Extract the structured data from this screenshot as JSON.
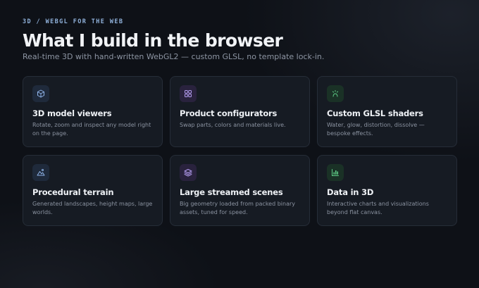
{
  "header": {
    "eyebrow": "3D / WEBGL FOR THE WEB",
    "title": "What I build in the browser",
    "subtitle": "Real-time 3D with hand-written WebGL2 — custom GLSL, no template lock-in."
  },
  "colors": {
    "background": "#0e1117",
    "card": "#161b23",
    "eyebrow": "#8fb0d9",
    "blue_accent": "#7fa6e0",
    "purple_accent": "#a48be6",
    "green_accent": "#4fc57a"
  },
  "cards": [
    {
      "icon": "cube-icon",
      "accent": "blue",
      "title": "3D model viewers",
      "description": "Rotate, zoom and inspect any model right on the page."
    },
    {
      "icon": "grid-squares-icon",
      "accent": "purple",
      "title": "Product configurators",
      "description": "Swap parts, colors and materials live."
    },
    {
      "icon": "sparkle-icon",
      "accent": "green",
      "title": "Custom GLSL shaders",
      "description": "Water, glow, distortion, dissolve — bespoke effects."
    },
    {
      "icon": "mountain-icon",
      "accent": "blue",
      "title": "Procedural terrain",
      "description": "Generated landscapes, height maps, large worlds."
    },
    {
      "icon": "layers-icon",
      "accent": "purple",
      "title": "Large streamed scenes",
      "description": "Big geometry loaded from packed binary assets, tuned for speed."
    },
    {
      "icon": "bar-chart-icon",
      "accent": "green",
      "title": "Data in 3D",
      "description": "Interactive charts and visualizations beyond flat canvas."
    }
  ]
}
